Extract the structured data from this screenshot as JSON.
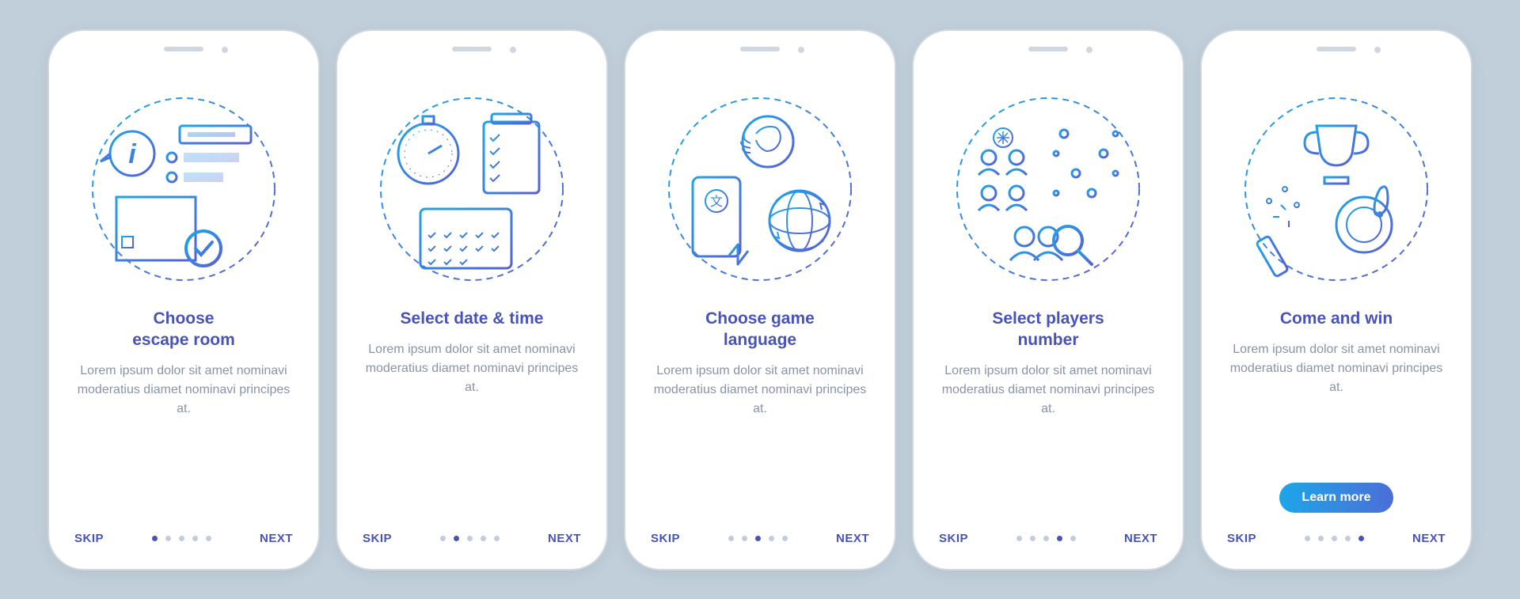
{
  "screens": [
    {
      "title": "Choose\nescape room",
      "description": "Lorem ipsum dolor sit amet nominavi moderatius diamet nominavi principes at.",
      "skip": "SKIP",
      "next": "NEXT",
      "activeDot": 0,
      "totalDots": 5,
      "hasCta": false
    },
    {
      "title": "Select date & time",
      "description": "Lorem ipsum dolor sit amet nominavi moderatius diamet nominavi principes at.",
      "skip": "SKIP",
      "next": "NEXT",
      "activeDot": 1,
      "totalDots": 5,
      "hasCta": false
    },
    {
      "title": "Choose game\nlanguage",
      "description": "Lorem ipsum dolor sit amet nominavi moderatius diamet nominavi principes at.",
      "skip": "SKIP",
      "next": "NEXT",
      "activeDot": 2,
      "totalDots": 5,
      "hasCta": false
    },
    {
      "title": "Select players\nnumber",
      "description": "Lorem ipsum dolor sit amet nominavi moderatius diamet nominavi principes at.",
      "skip": "SKIP",
      "next": "NEXT",
      "activeDot": 3,
      "totalDots": 5,
      "hasCta": false
    },
    {
      "title": "Come and win",
      "description": "Lorem ipsum dolor sit amet nominavi moderatius diamet nominavi principes at.",
      "skip": "SKIP",
      "next": "NEXT",
      "activeDot": 4,
      "totalDots": 5,
      "hasCta": true,
      "ctaLabel": "Learn more"
    }
  ],
  "colors": {
    "primary": "#4753b8",
    "gradientStart": "#1da6e8",
    "gradientEnd": "#4c6ed8",
    "background": "#c0cfda",
    "muted": "#8893a8"
  },
  "iconNames": [
    "escape-room-icon",
    "date-time-icon",
    "language-icon",
    "players-icon",
    "win-icon"
  ]
}
